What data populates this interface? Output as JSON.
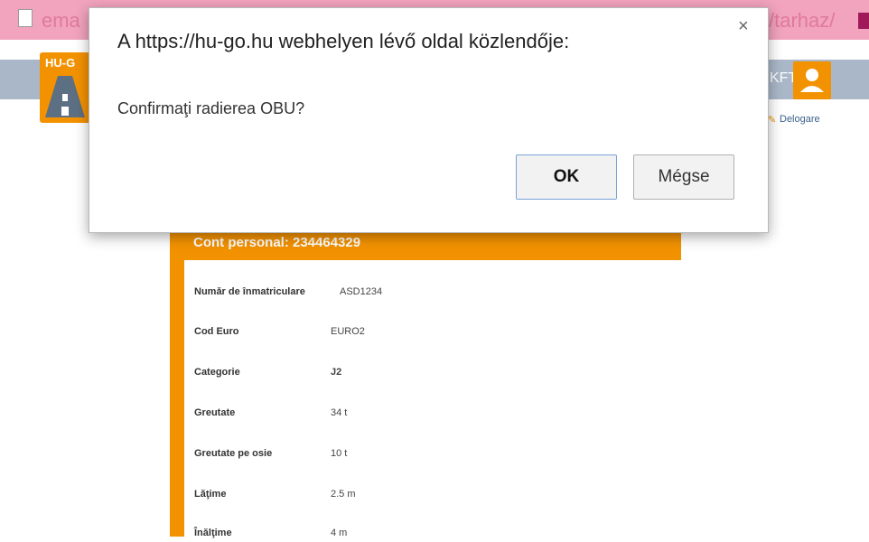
{
  "browser": {
    "url_left_fragment": "ema",
    "url_right_fragment": "/tarhaz/"
  },
  "site": {
    "logo_text": "HU-G",
    "company_fragment": "KFT",
    "delogare_icon": "✎",
    "logout_label": "Delogare"
  },
  "card": {
    "title": "Cont personal: 234464329",
    "rows": [
      {
        "label": "Număr de înmatriculare",
        "value": "ASD1234"
      },
      {
        "label": "Cod Euro",
        "value": "EURO2"
      },
      {
        "label": "Categorie",
        "value": "J2"
      },
      {
        "label": "Greutate",
        "value": "34 t"
      },
      {
        "label": "Greutate pe osie",
        "value": "10 t"
      },
      {
        "label": "Lăţime",
        "value": "2.5 m"
      },
      {
        "label": "Înălţime",
        "value": "4 m"
      }
    ]
  },
  "dialog": {
    "title": "A https://hu-go.hu webhelyen lévő oldal közlendője:",
    "message": "Confirmaţi radierea OBU?",
    "ok_label": "OK",
    "cancel_label": "Mégse",
    "close_symbol": "×"
  },
  "colors": {
    "accent": "#f39200",
    "navbar": "#a9b7c8",
    "address_bar": "#f2a3bd"
  },
  "icons": {
    "page": "page-icon",
    "user": "user-icon",
    "close": "close-icon"
  }
}
